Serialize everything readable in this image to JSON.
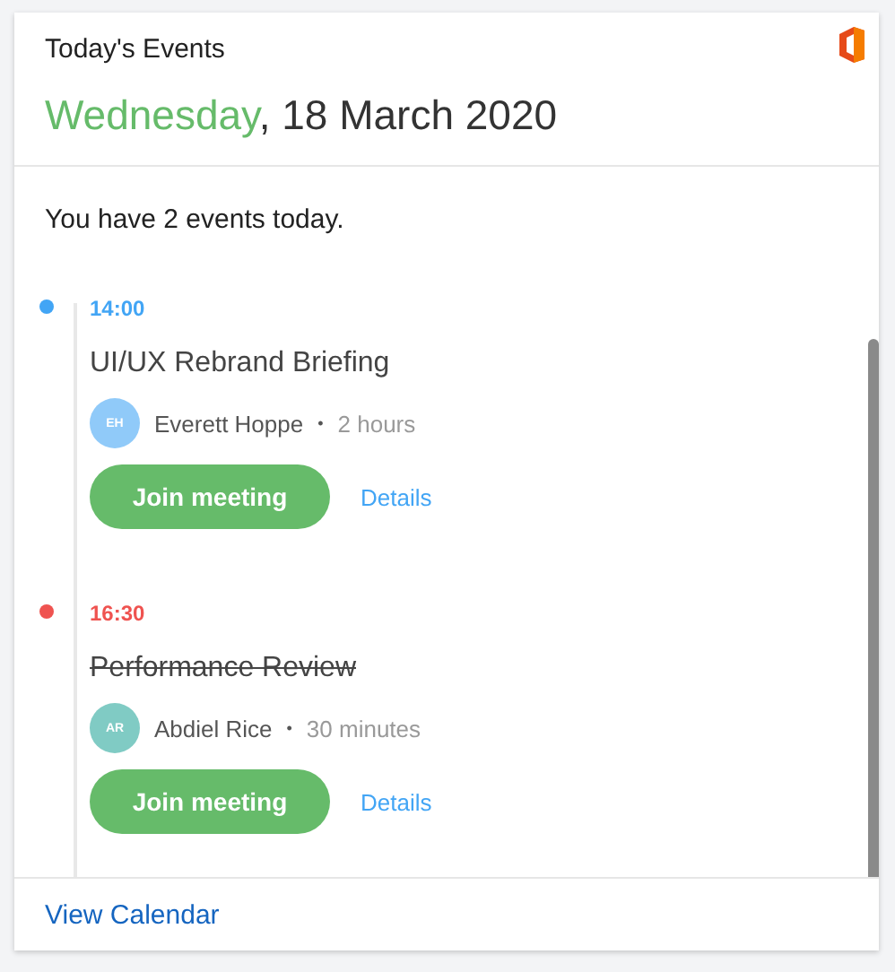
{
  "header": {
    "title": "Today's Events",
    "weekday": "Wednesday",
    "date": ", 18 March 2020"
  },
  "summary": "You have 2 events today.",
  "events": [
    {
      "time": "14:00",
      "color": "#42a5f5",
      "title": "UI/UX Rebrand Briefing",
      "cancelled": false,
      "avatar": {
        "initials": "EH",
        "color": "#90caf9"
      },
      "person": "Everett Hoppe",
      "separator": "•",
      "duration": "2 hours",
      "button": "Join meeting",
      "link": "Details"
    },
    {
      "time": "16:30",
      "color": "#ef5350",
      "title": "Performance Review",
      "cancelled": true,
      "avatar": {
        "initials": "AR",
        "color": "#80cbc4"
      },
      "person": "Abdiel Rice",
      "separator": "•",
      "duration": "30 minutes",
      "button": "Join meeting",
      "link": "Details"
    }
  ],
  "footer": {
    "link": "View Calendar"
  }
}
